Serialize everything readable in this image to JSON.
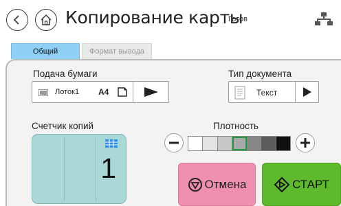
{
  "titlebar": {
    "title": "Копирование карты",
    "status": "Готов",
    "icons": [
      "back-arrow-icon",
      "home-icon",
      "network-icon"
    ]
  },
  "tabs": [
    {
      "label": "Общий",
      "selected": true
    },
    {
      "label": "Формат вывода",
      "selected": false
    }
  ],
  "paper_feed": {
    "label": "Подача бумаги",
    "tray": "Лоток1",
    "size": "A4",
    "icons": [
      "tray-icon",
      "portrait-orientation-icon",
      "play-arrow-icon"
    ]
  },
  "document_type": {
    "label": "Тип документа",
    "value": "Текст",
    "icons": [
      "text-document-icon",
      "play-arrow-icon"
    ]
  },
  "copy_counter": {
    "label": "Счетчик копий",
    "value": "1",
    "icon": "grid-keypad-icon"
  },
  "density": {
    "label": "Плотность",
    "levels": 7,
    "selected_level": 4,
    "segment_colors": [
      "#ffffff",
      "#e4e4e4",
      "#c8c8c8",
      "#a8a8a8",
      "#868686",
      "#5c5c5c",
      "#111111"
    ],
    "selected_outline": "#1e9e3c"
  },
  "actions": {
    "cancel_label": "Отмена",
    "start_label": "СТАРТ",
    "cancel_color": "#ef8fb0",
    "start_color": "#5fb92c"
  }
}
